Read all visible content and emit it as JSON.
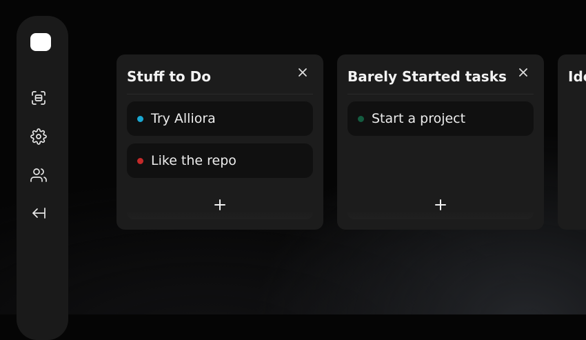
{
  "sidebar": {
    "items": [
      {
        "icon": "scan-icon"
      },
      {
        "icon": "gear-icon"
      },
      {
        "icon": "users-icon"
      },
      {
        "icon": "collapse-left-icon"
      }
    ]
  },
  "board": {
    "columns": [
      {
        "title": "Stuff to Do",
        "cards": [
          {
            "label": "Try Alliora",
            "color": "#1aa7d1"
          },
          {
            "label": "Like the repo",
            "color": "#c42a2a"
          }
        ]
      },
      {
        "title": "Barely Started tasks",
        "cards": [
          {
            "label": "Start a project",
            "color": "#145c40"
          }
        ]
      },
      {
        "title": "Ide",
        "cards": []
      }
    ]
  },
  "colors": {
    "background": "#050505",
    "sidebar": "#1a1a1a",
    "column": "#1c1c1c",
    "card": "#101010",
    "text": "#ededed"
  }
}
